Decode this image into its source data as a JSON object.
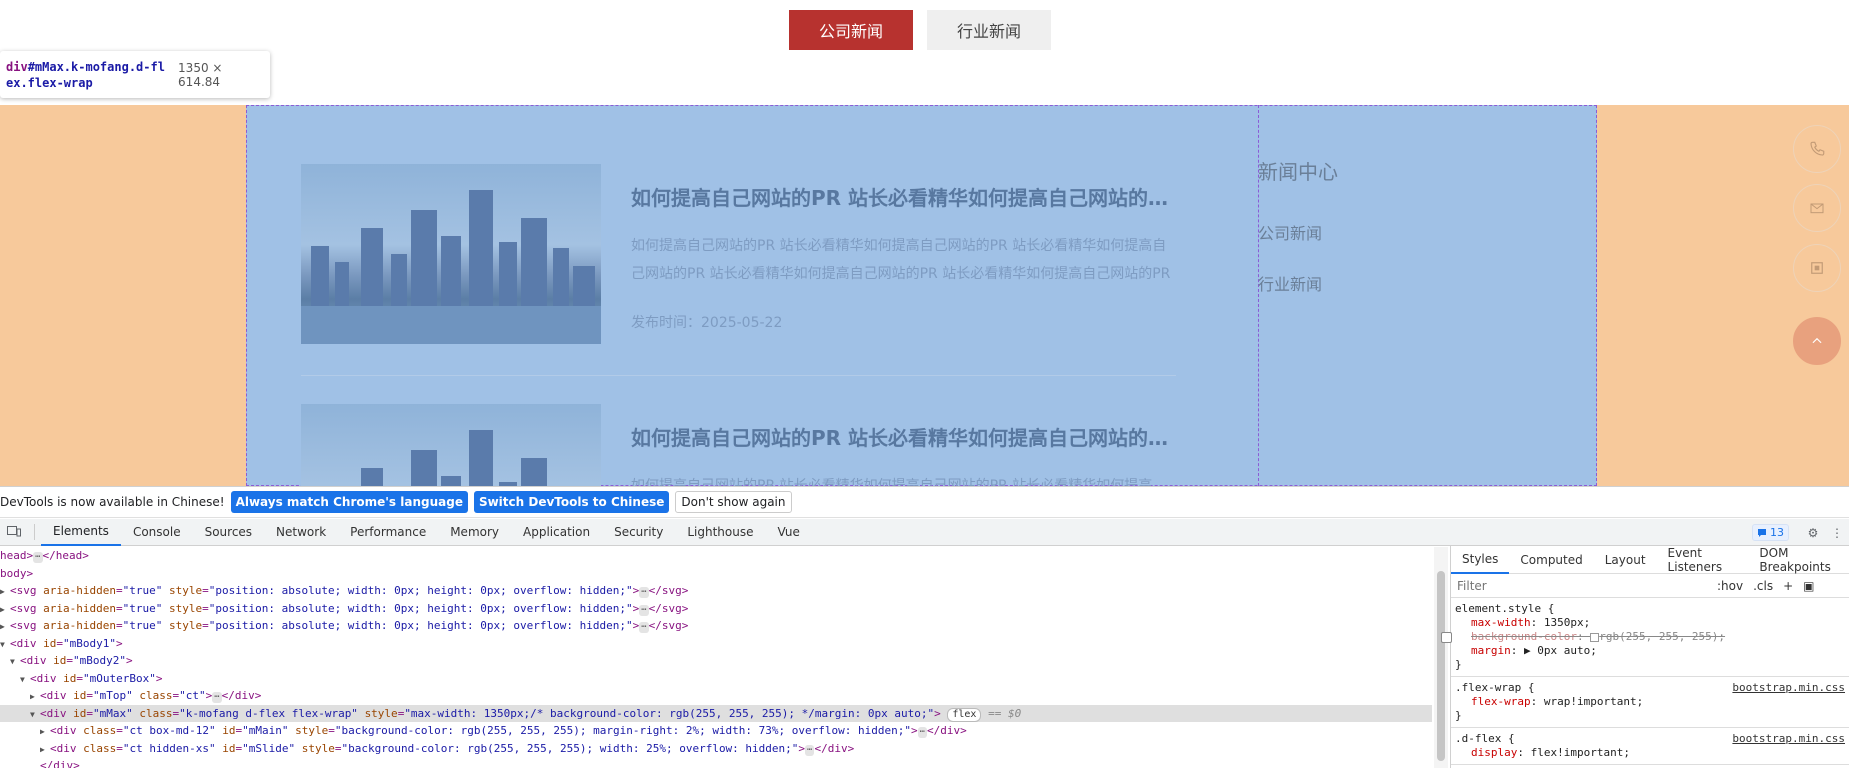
{
  "page": {
    "tabs": [
      {
        "label": "公司新闻",
        "active": true
      },
      {
        "label": "行业新闻",
        "active": false
      }
    ],
    "inspect_tooltip": {
      "tag": "div",
      "id_class": "#mMax.k-mofang.d-flex.flex-wrap",
      "dims": "1350 × 614.84"
    },
    "news": [
      {
        "title": "如何提高自己网站的PR 站长必看精华如何提高自己网站的PR 站长必看精华",
        "summary": "如何提高自己网站的PR 站长必看精华如何提高自己网站的PR 站长必看精华如何提高自己网站的PR 站长必看精华如何提高自己网站的PR 站长必看精华如何提高自己网站的PR 站长必看精华",
        "date": "发布时间：2025-05-22"
      },
      {
        "title": "如何提高自己网站的PR 站长必看精华如何提高自己网站的PR 站长必看精华",
        "summary": "如何提高自己网站的PR 站长必看精华如何提高自己网站的PR 站长必看精华如何提高",
        "date": ""
      }
    ],
    "sidebar": {
      "title": "新闻中心",
      "links": [
        "公司新闻",
        "行业新闻"
      ]
    },
    "float_buttons": [
      "phone-icon",
      "mail-icon",
      "qrcode-icon",
      "back-to-top-icon"
    ],
    "colors": {
      "accent": "#b7322f",
      "margin_overlay": "#f7c99b",
      "content_overlay": "#a0c1e6"
    }
  },
  "devtools": {
    "infobar": {
      "message": "DevTools is now available in Chinese!",
      "btn_match": "Always match Chrome's language",
      "btn_switch": "Switch DevTools to Chinese",
      "btn_dismiss": "Don't show again"
    },
    "tabs": [
      "Elements",
      "Console",
      "Sources",
      "Network",
      "Performance",
      "Memory",
      "Application",
      "Security",
      "Lighthouse",
      "Vue"
    ],
    "active_tab": "Elements",
    "issues_count": "13",
    "dom": {
      "l1": "head>",
      "l1b": "</head>",
      "l2": "body>",
      "svg_attr_aria": "aria-hidden",
      "svg_val_aria": "\"true\"",
      "svg_attr_style": "style",
      "svg_val_style": "\"position: absolute; width: 0px; height: 0px; overflow: hidden;\"",
      "svg_close": "</svg>",
      "mbody1": "\"mBody1\"",
      "mbody2": "\"mBody2\"",
      "mouter": "\"mOuterBox\"",
      "mtop_id": "\"mTop\"",
      "mtop_cls": "\"ct\"",
      "mmax_id": "\"mMax\"",
      "mmax_cls": "\"k-mofang d-flex flex-wrap\"",
      "mmax_style": "\"max-width: 1350px;/* background-color: rgb(255, 255, 255); */margin: 0px auto;\"",
      "flex_badge": "flex",
      "eq0": "== $0",
      "mmain_cls": "\"ct box-md-12\"",
      "mmain_id": "\"mMain\"",
      "mmain_style": "\"background-color: rgb(255, 255, 255); margin-right: 2%; width: 73%; overflow: hidden;\"",
      "mslide_cls": "\"ct hidden-xs\"",
      "mslide_id": "\"mSlide\"",
      "mslide_style": "\"background-color: rgb(255, 255, 255); width: 25%; overflow: hidden;\"",
      "div_close": "</div>"
    },
    "styles": {
      "subtabs": [
        "Styles",
        "Computed",
        "Layout",
        "Event Listeners",
        "DOM Breakpoints"
      ],
      "filter_placeholder": "Filter",
      "hov": ":hov",
      "cls": ".cls",
      "rule1_selector": "element.style {",
      "rule1_p1": "max-width",
      "rule1_v1": "1350px;",
      "rule1_p2": "background-color",
      "rule1_v2": "rgb(255, 255, 255);",
      "rule1_p3": "margin",
      "rule1_v3": "0px auto;",
      "close": "}",
      "rule2_selector": ".flex-wrap {",
      "rule2_source": "bootstrap.min.css",
      "rule2_p1": "flex-wrap",
      "rule2_v1": "wrap!important;",
      "rule3_selector": ".d-flex {",
      "rule3_source": "bootstrap.min.css",
      "rule3_p1": "display",
      "rule3_v1": "flex!important;"
    }
  }
}
